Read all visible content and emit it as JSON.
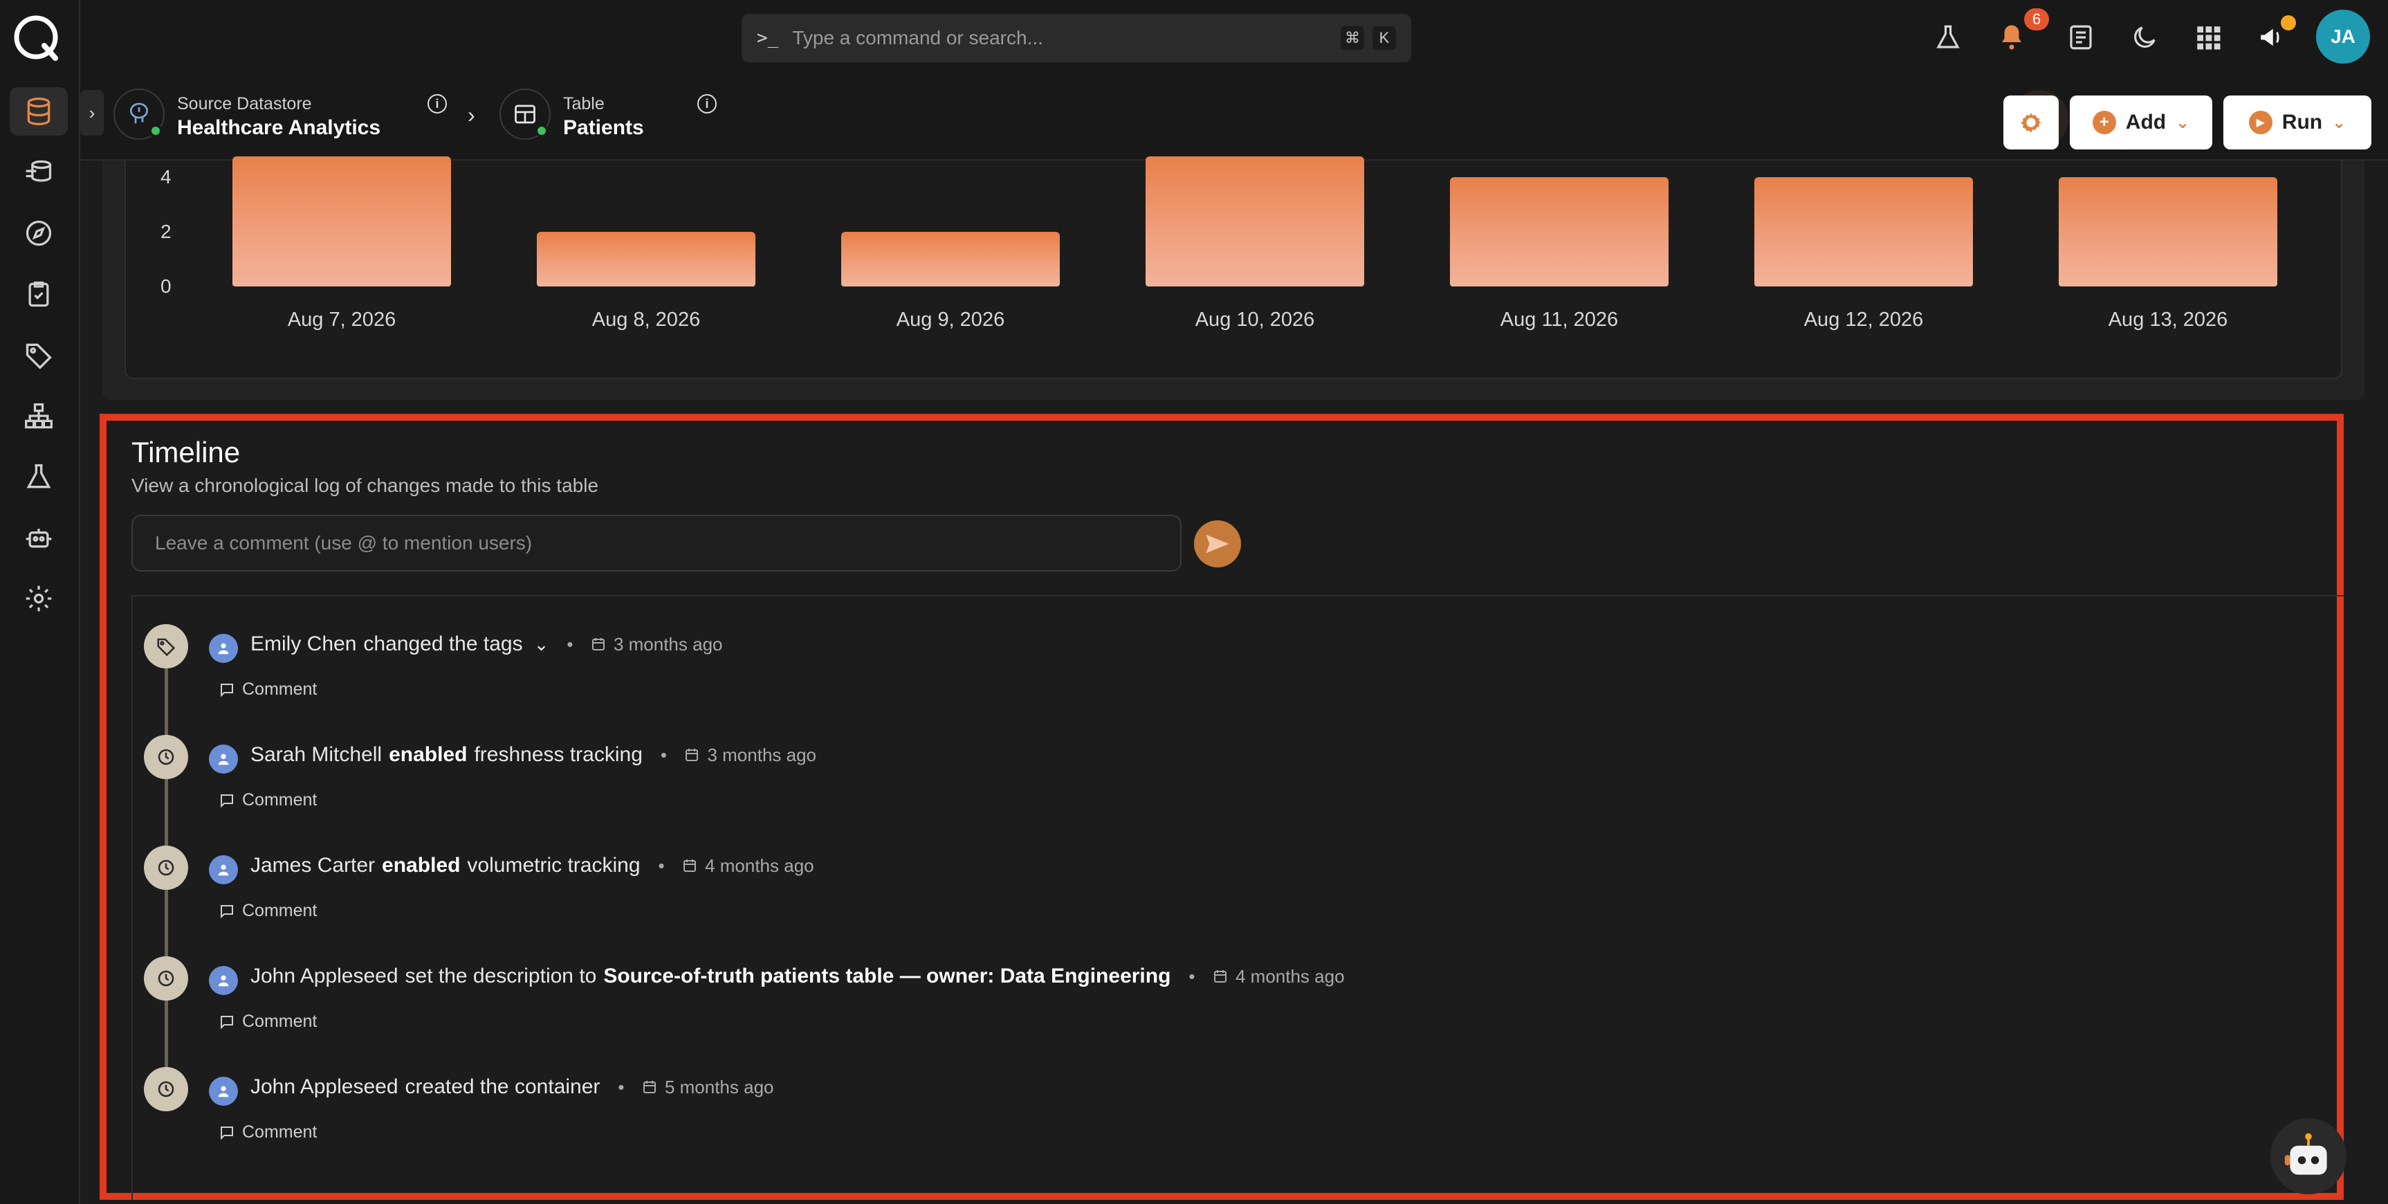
{
  "topbar": {
    "search_placeholder": "Type a command or search...",
    "shortcut_mod": "⌘",
    "shortcut_key": "K",
    "notification_count": "6",
    "avatar_initials": "JA"
  },
  "sidebar": {
    "items": [
      "datastores-icon",
      "flow-icon",
      "explore-icon",
      "checks-icon",
      "tags-icon",
      "hierarchy-icon",
      "lab-icon",
      "agent-icon",
      "settings-icon"
    ],
    "active": "datastores-icon"
  },
  "breadcrumb": {
    "datastore_label": "Source Datastore",
    "datastore_value": "Healthcare Analytics",
    "table_label": "Table",
    "table_value": "Patients"
  },
  "actions": {
    "add_label": "Add",
    "run_label": "Run"
  },
  "chart_data": {
    "type": "bar",
    "categories": [
      "Aug 7, 2026",
      "Aug 8, 2026",
      "Aug 9, 2026",
      "Aug 10, 2026",
      "Aug 11, 2026",
      "Aug 12, 2026",
      "Aug 13, 2026"
    ],
    "values": [
      6,
      2,
      2,
      6,
      4,
      4,
      4
    ],
    "y_ticks": [
      "4",
      "2",
      "0"
    ],
    "colors": {
      "bar_top": "#e8804a",
      "bar_bottom": "#f3b39a"
    }
  },
  "timeline": {
    "title": "Timeline",
    "subtitle": "View a chronological log of changes made to this table",
    "comment_placeholder": "Leave a comment (use @ to mention users)",
    "comment_label": "Comment",
    "events": [
      {
        "icon": "tag-icon",
        "user": "Emily Chen",
        "pre": "changed the tags",
        "bold": "",
        "post": "",
        "time": "3 months ago",
        "expandable": true
      },
      {
        "icon": "clock-icon",
        "user": "Sarah Mitchell",
        "pre": "",
        "bold": "enabled",
        "post": "freshness tracking",
        "time": "3 months ago"
      },
      {
        "icon": "clock-icon",
        "user": "James Carter",
        "pre": "",
        "bold": "enabled",
        "post": "volumetric tracking",
        "time": "4 months ago"
      },
      {
        "icon": "clock-icon",
        "user": "John Appleseed",
        "pre": "set the description to",
        "bold": "Source-of-truth patients table — owner: Data Engineering",
        "post": "",
        "time": "4 months ago"
      },
      {
        "icon": "clock-icon",
        "user": "John Appleseed",
        "pre": "created the container",
        "bold": "",
        "post": "",
        "time": "5 months ago"
      }
    ]
  }
}
